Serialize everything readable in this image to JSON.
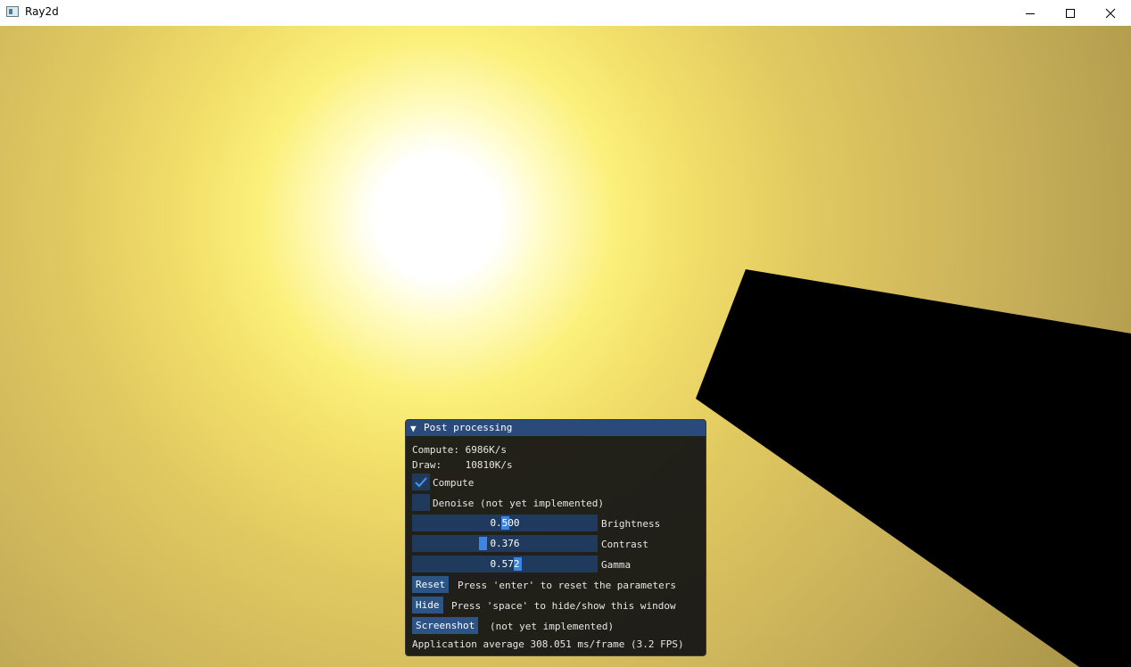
{
  "window": {
    "title": "Ray2d",
    "controls": [
      "minimize-icon",
      "maximize-icon",
      "close-icon"
    ]
  },
  "colors": {
    "light_center": "#ffffff",
    "light_glow": "#fbf07a",
    "background_edge": "#8e7c3c",
    "occluder": "#000000",
    "panel_header": "#294a7a",
    "panel_bg": "#141414",
    "widget_bg": "#203a5e",
    "slider_grab": "#3d85e0",
    "button_bg": "#2d5486"
  },
  "panel": {
    "title": "Post processing",
    "collapse_icon": "▼",
    "compute_stat": "Compute: 6986K/s",
    "draw_stat": "Draw:    10810K/s",
    "checkboxes": [
      {
        "label": "Compute",
        "checked": true
      },
      {
        "label": "Denoise (not yet implemented)",
        "checked": false
      }
    ],
    "sliders": [
      {
        "label": "Brightness",
        "value": "0.500",
        "fraction": 0.5
      },
      {
        "label": "Contrast",
        "value": "0.376",
        "fraction": 0.376
      },
      {
        "label": "Gamma",
        "value": "0.572",
        "fraction": 0.572
      }
    ],
    "buttons": [
      {
        "label": "Reset",
        "description": "Press 'enter' to reset the parameters"
      },
      {
        "label": "Hide",
        "description": "Press 'space' to hide/show this window"
      },
      {
        "label": "Screenshot",
        "description": "(not yet implemented)"
      }
    ],
    "fps_text": "Application average 308.051 ms/frame (3.2 FPS)"
  }
}
